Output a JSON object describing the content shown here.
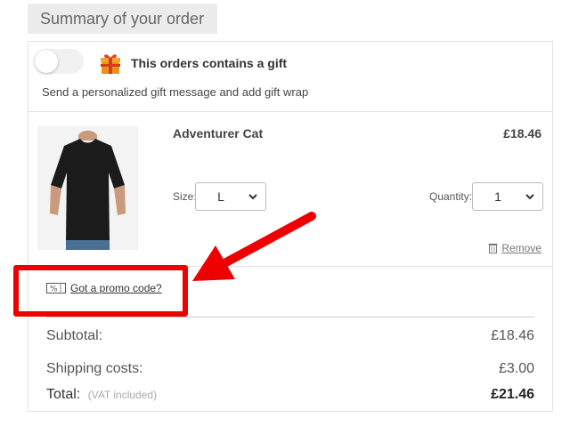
{
  "header": {
    "title": "Summary of your order"
  },
  "gift": {
    "toggle_on": false,
    "title": "This orders contains a gift",
    "description": "Send a personalized gift message and add gift wrap"
  },
  "product": {
    "name": "Adventurer Cat",
    "price": "£18.46",
    "size_label": "Size:",
    "size_value": "L",
    "quantity_label": "Quantity:",
    "quantity_value": "1",
    "remove_label": "Remove"
  },
  "promo": {
    "label": "Got a promo code?"
  },
  "totals": {
    "subtotal_label": "Subtotal:",
    "subtotal_value": "£18.46",
    "shipping_label": "Shipping costs:",
    "shipping_value": "£3.00",
    "total_label": "Total:",
    "vat_note": "(VAT included)",
    "total_value": "£21.46"
  },
  "colors": {
    "annotation": "#ee0000",
    "header_bg": "#ececec"
  }
}
